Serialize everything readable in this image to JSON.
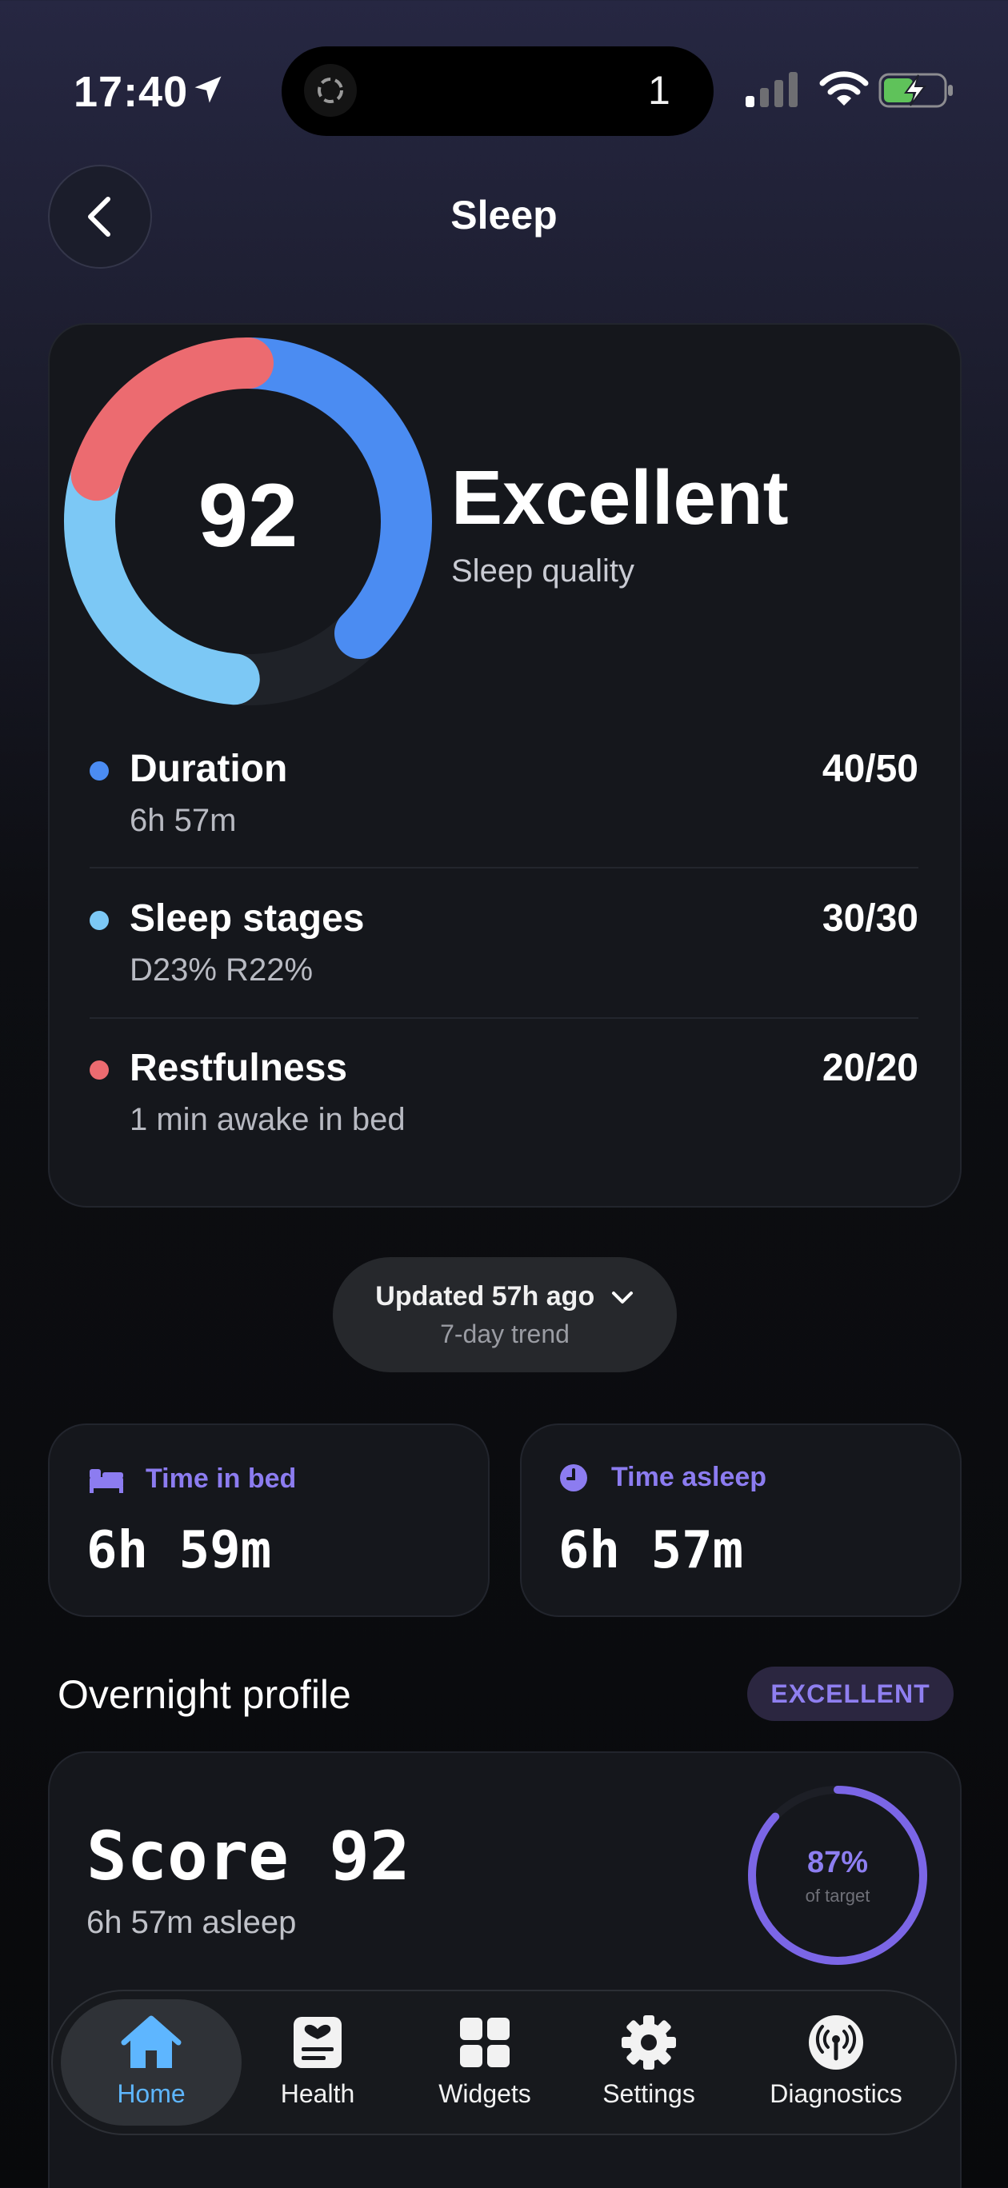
{
  "status_bar": {
    "time": "17:40",
    "island_count": "1"
  },
  "header": {
    "title": "Sleep"
  },
  "summary": {
    "score": "92",
    "verdict": "Excellent",
    "subtitle": "Sleep quality",
    "ring_colors": {
      "duration": "#4b8cf2",
      "stages": "#7cc8f5",
      "restfulness": "#ec6b70"
    }
  },
  "metrics": [
    {
      "name": "Duration",
      "detail": "6h 57m",
      "score": "40/50",
      "color": "#4b8cf2"
    },
    {
      "name": "Sleep stages",
      "detail": "D23% R22%",
      "score": "30/30",
      "color": "#7cc8f5"
    },
    {
      "name": "Restfulness",
      "detail": "1 min awake in bed",
      "score": "20/20",
      "color": "#ec6b70"
    }
  ],
  "updated": {
    "text": "Updated 57h ago",
    "subtext": "7-day trend"
  },
  "tiles": {
    "in_bed": {
      "label": "Time in bed",
      "value": "6h 59m"
    },
    "asleep": {
      "label": "Time asleep",
      "value": "6h 57m"
    }
  },
  "overnight": {
    "title": "Overnight profile",
    "badge": "EXCELLENT",
    "score_text": "Score 92",
    "asleep_text": "6h 57m asleep",
    "target_pct": "87%",
    "target_label": "of target",
    "target_fraction": 0.87
  },
  "tabbar": {
    "items": [
      {
        "label": "Home",
        "icon": "home-icon",
        "active": true
      },
      {
        "label": "Health",
        "icon": "health-icon"
      },
      {
        "label": "Widgets",
        "icon": "widgets-icon"
      },
      {
        "label": "Settings",
        "icon": "gear-icon"
      },
      {
        "label": "Diagnostics",
        "icon": "antenna-icon"
      }
    ]
  }
}
